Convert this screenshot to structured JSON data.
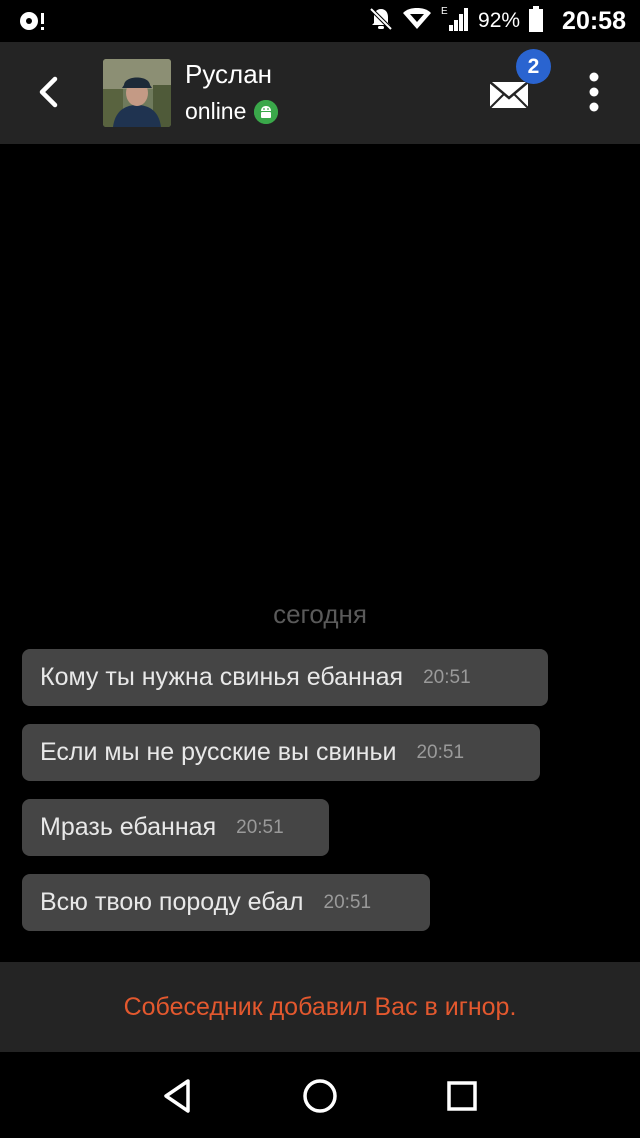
{
  "status_bar": {
    "battery_percent": "92%",
    "time": "20:58",
    "network_type": "E",
    "icons": [
      "media-icon",
      "notifications-off-icon",
      "wifi-icon",
      "signal-icon",
      "battery-icon"
    ]
  },
  "header": {
    "contact_name": "Руслан",
    "status": "online",
    "unread_count": "2",
    "icons": [
      "back-arrow-icon",
      "avatar",
      "android-icon",
      "mail-icon",
      "more-vert-icon"
    ]
  },
  "chat": {
    "date_label": "сегодня",
    "messages": [
      {
        "text": "Кому ты нужна свинья ебанная",
        "time": "20:51"
      },
      {
        "text": "Если мы не русские вы свиньи",
        "time": "20:51"
      },
      {
        "text": "Мразь ебанная",
        "time": "20:51"
      },
      {
        "text": "Всю твою породу ебал",
        "time": "20:51"
      }
    ]
  },
  "banner": {
    "text": "Собеседник добавил Вас в игнор."
  },
  "colors": {
    "app_bar": "#242424",
    "bubble": "#454545",
    "banner_text": "#e3582e",
    "badge": "#2a64d0",
    "online_badge": "#3aa84a"
  },
  "nav": {
    "icons": [
      "back-triangle-icon",
      "home-circle-icon",
      "recents-square-icon"
    ]
  }
}
